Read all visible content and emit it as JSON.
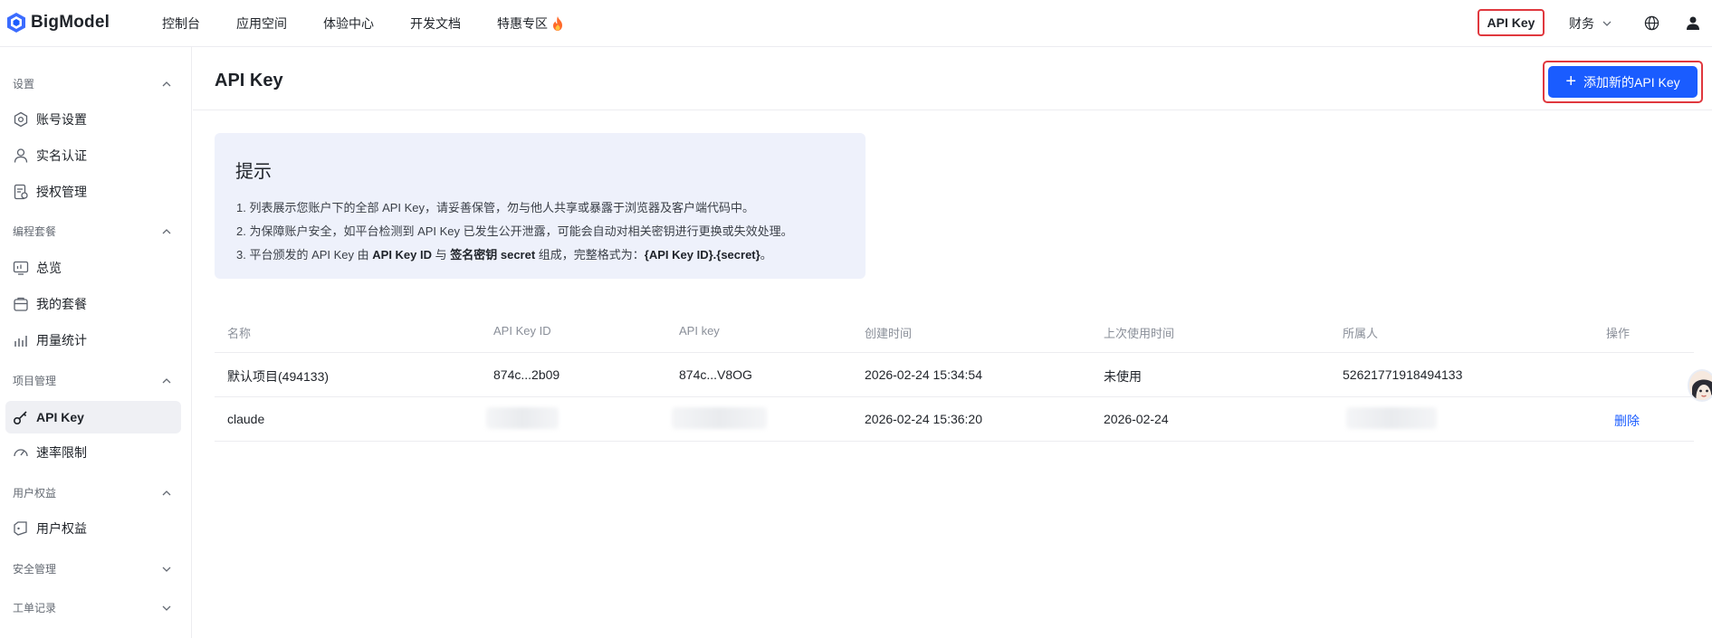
{
  "brand": {
    "name": "BigModel",
    "accent": "#1a5cff",
    "highlight": "#e0383e"
  },
  "nav": {
    "items": [
      "控制台",
      "应用空间",
      "体验中心",
      "开发文档",
      "特惠专区"
    ],
    "apikey": "API Key",
    "finance": "财务"
  },
  "sidebar": {
    "groups": [
      {
        "title": "设置",
        "items": [
          "账号设置",
          "实名认证",
          "授权管理"
        ]
      },
      {
        "title": "编程套餐",
        "items": [
          "总览",
          "我的套餐",
          "用量统计"
        ]
      },
      {
        "title": "项目管理",
        "items": [
          "API Key",
          "速率限制"
        ]
      },
      {
        "title": "用户权益",
        "items": [
          "用户权益"
        ]
      },
      {
        "title": "安全管理",
        "items": []
      },
      {
        "title": "工单记录",
        "items": []
      }
    ],
    "active": "API Key"
  },
  "page": {
    "title": "API Key",
    "add_button": "添加新的API Key"
  },
  "tip": {
    "title": "提示",
    "line1": "1. 列表展示您账户下的全部 API Key，请妥善保管，勿与他人共享或暴露于浏览器及客户端代码中。",
    "line2": "2. 为保障账户安全，如平台检测到 API Key 已发生公开泄露，可能会自动对相关密钥进行更换或失效处理。",
    "line3_pre": "3. 平台颁发的 API Key 由 ",
    "line3_b1": "API Key ID",
    "line3_mid1": " 与 ",
    "line3_b2": "签名密钥 secret",
    "line3_mid2": " 组成，完整格式为：",
    "line3_b3": "{API Key ID}.{secret}",
    "line3_end": "。"
  },
  "table": {
    "columns": [
      "名称",
      "API Key ID",
      "API key",
      "创建时间",
      "上次使用时间",
      "所属人",
      "操作"
    ],
    "rows": [
      {
        "name": "默认项目(494133)",
        "key_id": "874c...2b09",
        "api_key": "874c...V8OG",
        "created": "2026-02-24 15:34:54",
        "last_used": "未使用",
        "owner": "52621771918494133",
        "action": ""
      },
      {
        "name": "claude",
        "key_id": "",
        "api_key": "",
        "created": "2026-02-24 15:36:20",
        "last_used": "2026-02-24",
        "owner": "",
        "action": "删除"
      }
    ]
  }
}
